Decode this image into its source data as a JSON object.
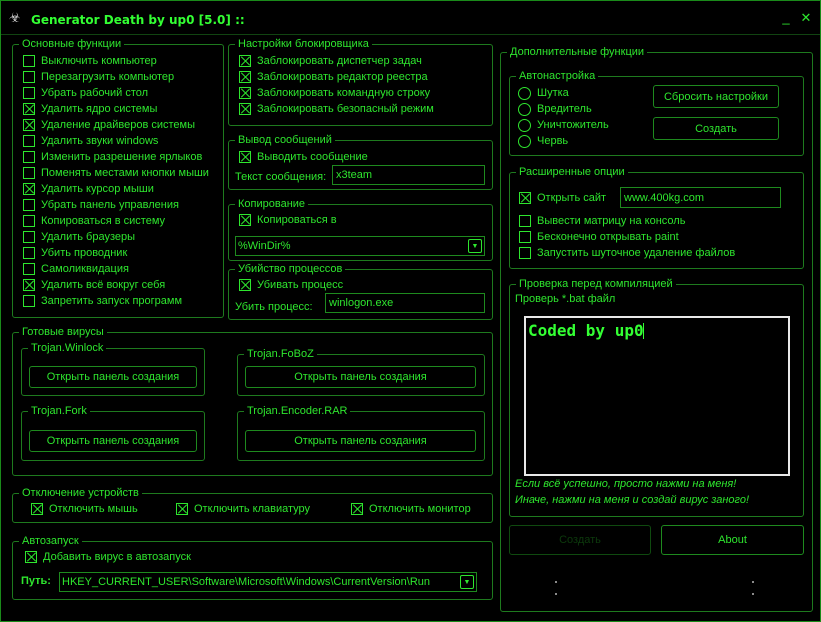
{
  "window": {
    "title": "Generator Death by up0 [5.0] ::",
    "icon": "death-logo-icon",
    "minimize": "_",
    "close": "✕"
  },
  "colors": {
    "accent": "#2ee62e",
    "background": "#000000",
    "border": "#1e7a1e"
  },
  "basic": {
    "title": "Основные функции",
    "items": [
      {
        "label": "Выключить компьютер",
        "checked": false
      },
      {
        "label": "Перезагрузить компьютер",
        "checked": false
      },
      {
        "label": "Убрать рабочий стол",
        "checked": false
      },
      {
        "label": "Удалить ядро системы",
        "checked": true
      },
      {
        "label": "Удаление драйверов системы",
        "checked": true
      },
      {
        "label": "Удалить звуки windows",
        "checked": false
      },
      {
        "label": "Изменить разрешение ярлыков",
        "checked": false
      },
      {
        "label": "Поменять местами кнопки мыши",
        "checked": false
      },
      {
        "label": "Удалить курсор мыши",
        "checked": true
      },
      {
        "label": "Убрать панель управления",
        "checked": false
      },
      {
        "label": "Копироваться в систему",
        "checked": false
      },
      {
        "label": "Удалить браузеры",
        "checked": false
      },
      {
        "label": "Убить проводник",
        "checked": false
      },
      {
        "label": "Самоликвидация",
        "checked": false
      },
      {
        "label": "Удалить всё вокруг себя",
        "checked": true
      },
      {
        "label": "Запретить запуск программ",
        "checked": false
      }
    ]
  },
  "blocker": {
    "title": "Настройки блокировщика",
    "items": [
      {
        "label": "Заблокировать диспетчер задач",
        "checked": true
      },
      {
        "label": "Заблокировать редактор реестра",
        "checked": true
      },
      {
        "label": "Заблокировать командную строку",
        "checked": true
      },
      {
        "label": "Заблокировать безопасный режим",
        "checked": true
      }
    ]
  },
  "messages": {
    "title": "Вывод сообщений",
    "show_label": "Выводить сообщение",
    "show_checked": true,
    "text_label": "Текст сообщения:",
    "text_value": "x3team"
  },
  "copying": {
    "title": "Копирование",
    "copy_label": "Копироваться в",
    "copy_checked": true,
    "path_value": "%WinDir%"
  },
  "killproc": {
    "title": "Убийство процессов",
    "kill_label": "Убивать процесс",
    "kill_checked": true,
    "proc_label": "Убить процесс:",
    "proc_value": "winlogon.exe"
  },
  "ready": {
    "title": "Готовые вирусы",
    "viruses": [
      {
        "name": "Trojan.Winlock",
        "button": "Открыть панель создания"
      },
      {
        "name": "Trojan.FoBoZ",
        "button": "Открыть панель создания"
      },
      {
        "name": "Trojan.Fork",
        "button": "Открыть панель создания"
      },
      {
        "name": "Trojan.Encoder.RAR",
        "button": "Открыть панель создания"
      }
    ]
  },
  "devices": {
    "title": "Отключение устройств",
    "items": [
      {
        "label": "Отключить мышь",
        "checked": true
      },
      {
        "label": "Отключить клавиатуру",
        "checked": true
      },
      {
        "label": "Отключить монитор",
        "checked": true
      }
    ]
  },
  "autorun": {
    "title": "Автозапуск",
    "add_label": "Добавить вирус в автозапуск",
    "add_checked": true,
    "path_label": "Путь:",
    "path_value": "HKEY_CURRENT_USER\\Software\\Microsoft\\Windows\\CurrentVersion\\Run"
  },
  "extra": {
    "title": "Дополнительные функции",
    "autoconf": {
      "title": "Автонастройка",
      "radios": [
        "Шутка",
        "Вредитель",
        "Уничтожитель",
        "Червь"
      ],
      "reset_button": "Сбросить настройки",
      "create_button": "Создать"
    },
    "advanced": {
      "title": "Расширенные опции",
      "open_site_label": "Открыть сайт",
      "open_site_checked": true,
      "site_value": "www.400kg.com",
      "items": [
        {
          "label": "Вывести матрицу на консоль",
          "checked": false
        },
        {
          "label": "Бесконечно открывать paint",
          "checked": false
        },
        {
          "label": "Запустить шуточное удаление файлов",
          "checked": false
        }
      ]
    },
    "check": {
      "title": "Проверка перед компиляцией",
      "subtitle": "Проверь *.bat файл",
      "preview_text": "Coded by up0",
      "hint1": "Если всё успешно, просто нажми на меня!",
      "hint2": "Иначе, нажми на меня и создай вирус заного!"
    },
    "create_button": "Создать",
    "about_button": "About"
  }
}
